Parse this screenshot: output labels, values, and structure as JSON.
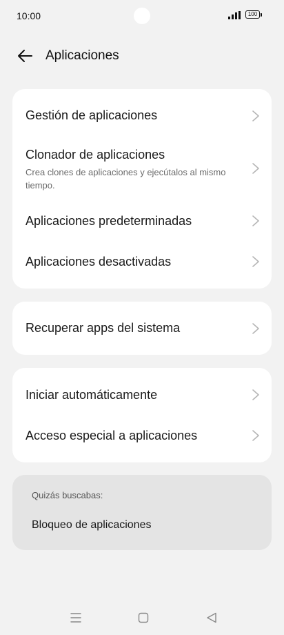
{
  "status_bar": {
    "time": "10:00",
    "battery": "100",
    "signal_icon": "signal-icon",
    "battery_icon": "battery-icon"
  },
  "header": {
    "title": "Aplicaciones",
    "back_icon": "arrow-left-icon"
  },
  "groups": [
    {
      "items": [
        {
          "label": "Gestión de aplicaciones"
        },
        {
          "label": "Clonador de aplicaciones",
          "subtitle": "Crea clones de aplicaciones y ejecútalos al mismo tiempo."
        },
        {
          "label": "Aplicaciones predeterminadas"
        },
        {
          "label": "Aplicaciones desactivadas"
        }
      ]
    },
    {
      "items": [
        {
          "label": "Recuperar apps del sistema"
        }
      ]
    },
    {
      "items": [
        {
          "label": "Iniciar automáticamente"
        },
        {
          "label": "Acceso especial a aplicaciones"
        }
      ]
    }
  ],
  "suggestion": {
    "title": "Quizás buscabas:",
    "link": "Bloqueo de aplicaciones"
  },
  "nav_bar": {
    "icons": [
      "menu-icon",
      "home-icon",
      "back-triangle-icon"
    ]
  },
  "colors": {
    "background": "#f2f2f2",
    "card": "#ffffff",
    "suggestion_card": "#e4e4e4",
    "chevron": "#b5b5b5"
  }
}
